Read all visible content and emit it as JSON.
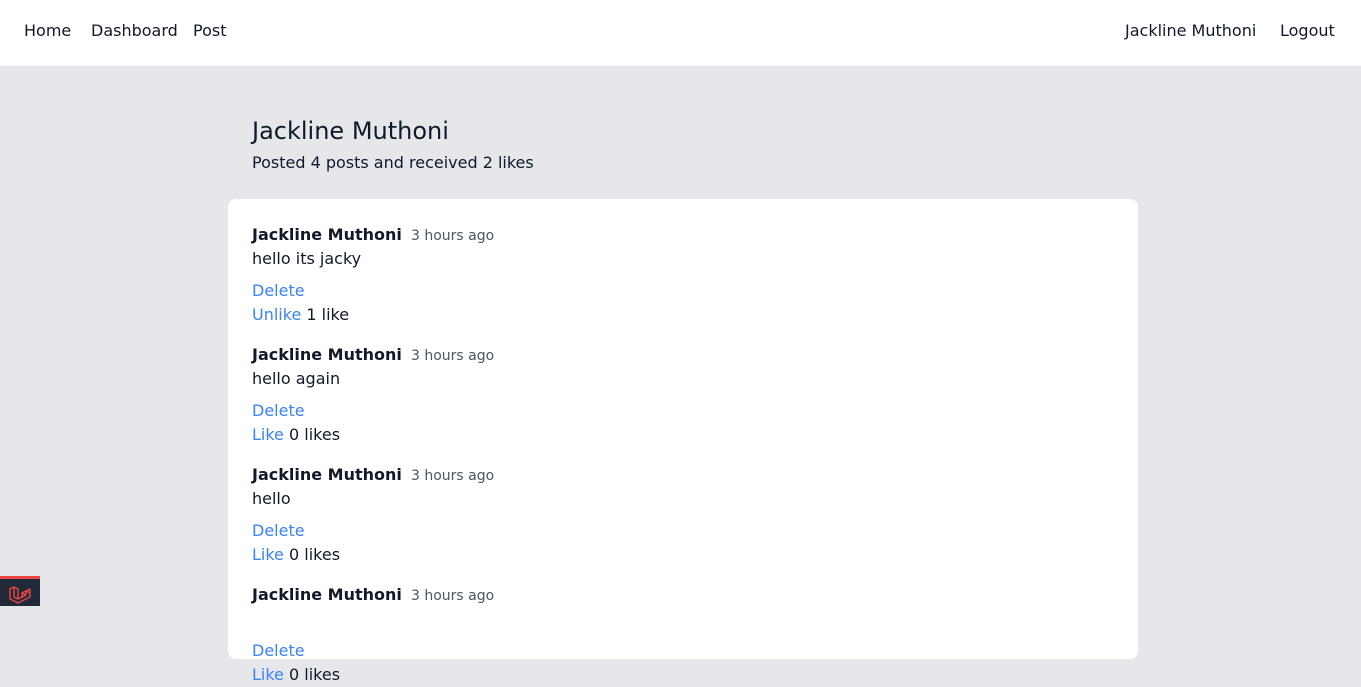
{
  "nav": {
    "home": "Home",
    "dashboard": "Dashboard",
    "post": "Post",
    "user": "Jackline Muthoni",
    "logout": "Logout"
  },
  "profile": {
    "name": "Jackline Muthoni",
    "stats": "Posted 4 posts and received 2 likes"
  },
  "posts": [
    {
      "author": "Jackline Muthoni",
      "time": "3 hours ago",
      "body": "hello its jacky",
      "delete_label": "Delete",
      "like_label": "Unlike",
      "likes_text": "1 like"
    },
    {
      "author": "Jackline Muthoni",
      "time": "3 hours ago",
      "body": "hello again",
      "delete_label": "Delete",
      "like_label": "Like",
      "likes_text": "0 likes"
    },
    {
      "author": "Jackline Muthoni",
      "time": "3 hours ago",
      "body": "hello",
      "delete_label": "Delete",
      "like_label": "Like",
      "likes_text": "0 likes"
    },
    {
      "author": "Jackline Muthoni",
      "time": "3 hours ago",
      "body": "",
      "delete_label": "Delete",
      "like_label": "Like",
      "likes_text": "0 likes"
    }
  ],
  "colors": {
    "link": "#3b82f6",
    "page_bg": "#e5e7eb",
    "card_bg": "#ffffff",
    "badge_accent": "#ef4444"
  },
  "icons": {
    "debug_badge": "laravel-logo-icon"
  }
}
